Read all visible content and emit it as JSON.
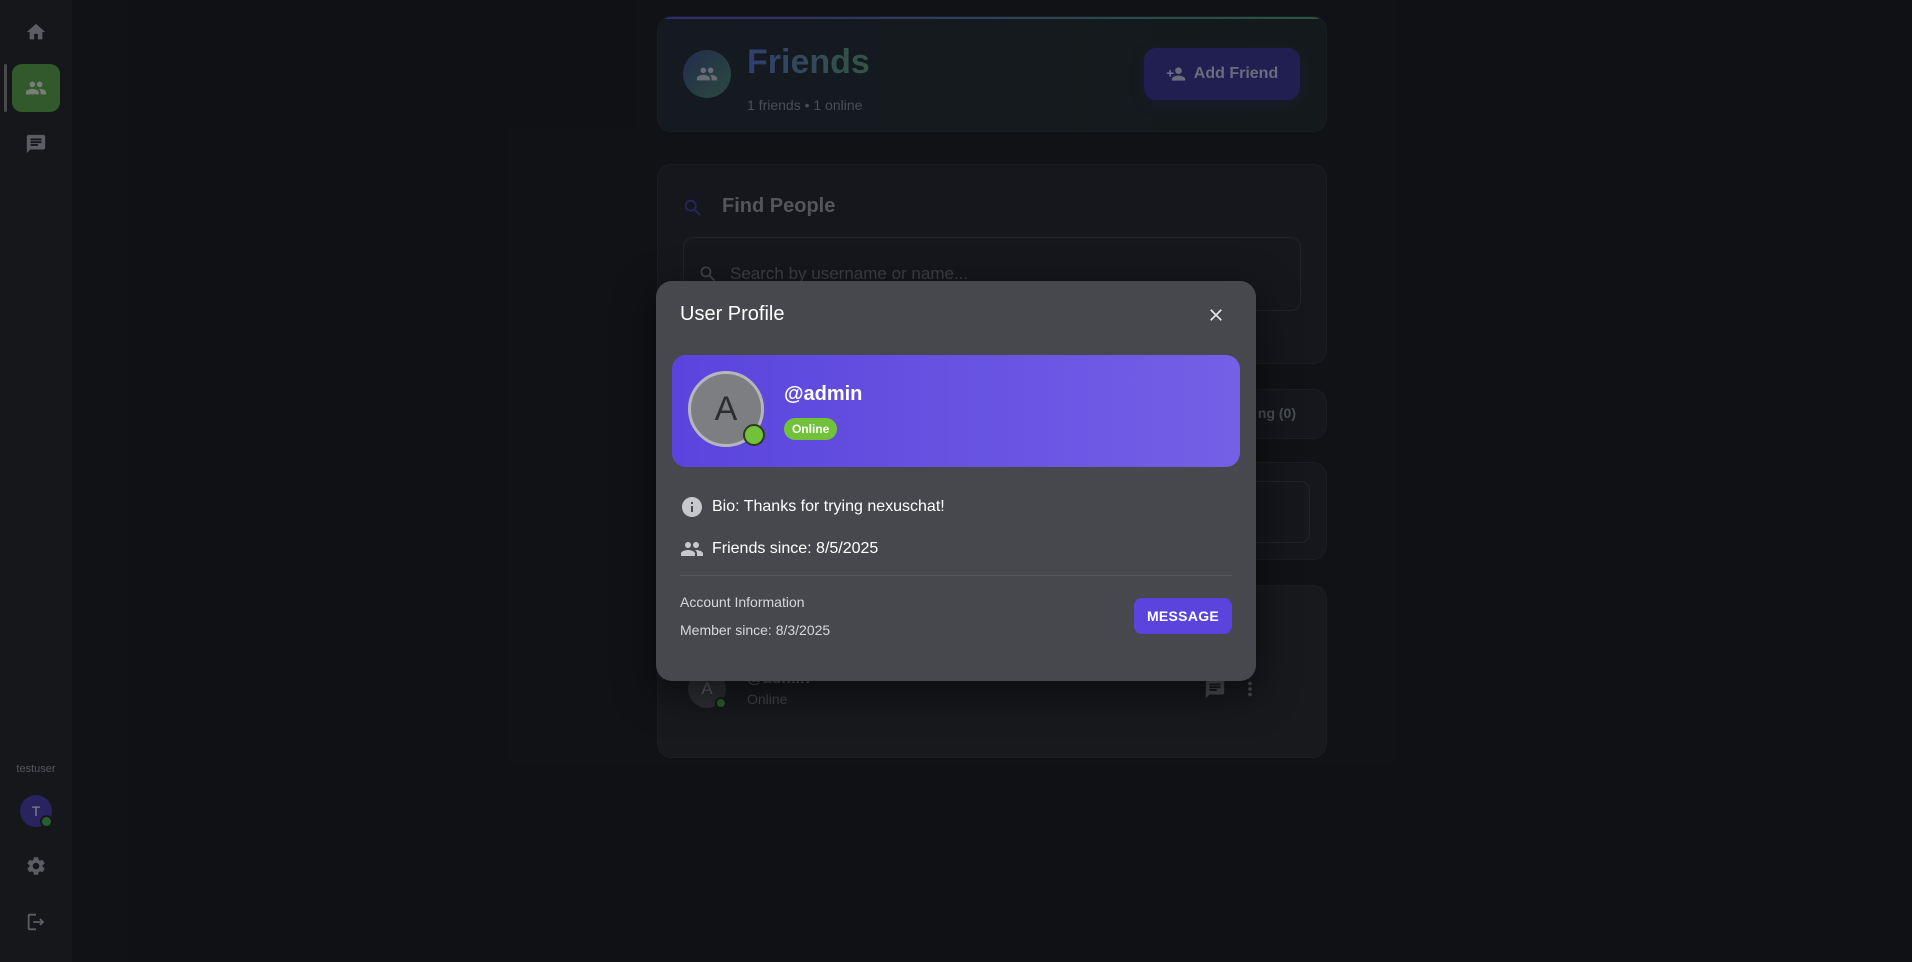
{
  "sidebar": {
    "nav": [
      {
        "icon": "home-icon"
      },
      {
        "icon": "friends-icon",
        "active": true
      },
      {
        "icon": "chat-icon"
      }
    ],
    "username": "testuser",
    "avatar_initial": "T",
    "settings_icon": "gear-icon",
    "logout_icon": "logout-icon"
  },
  "header": {
    "title": "Friends",
    "subtitle": "1 friends • 1 online",
    "add_button": "Add Friend"
  },
  "find": {
    "title": "Find People",
    "search_placeholder": "Search by username or name..."
  },
  "tabs": {
    "visible_tab": "ng (0)"
  },
  "friend_list": [
    {
      "initial": "A",
      "name": "@admin",
      "status": "Online"
    }
  ],
  "modal": {
    "title": "User Profile",
    "avatar_initial": "A",
    "handle": "@admin",
    "status_badge": "Online",
    "bio": "Bio: Thanks for trying nexuschat!",
    "friends_since": "Friends since: 8/5/2025",
    "account_info_label": "Account Information",
    "member_since": "Member since: 8/3/2025",
    "message_button": "MESSAGE"
  },
  "colors": {
    "accent": "#5a44dd",
    "online": "#72c239",
    "sidebar_active": "#5ba84a"
  }
}
